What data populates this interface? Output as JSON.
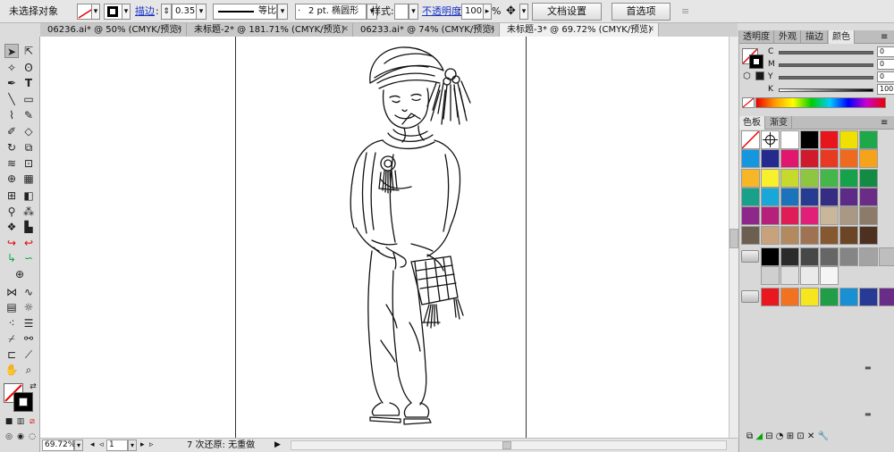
{
  "control_bar": {
    "selection_status": "未选择对象",
    "stroke_label": "描边",
    "stroke_weight": "0.353",
    "stroke_profile": "等比",
    "brush_value": "2 pt. 椭圆形",
    "style_label": "样式:",
    "opacity_label": "不透明度",
    "opacity_value": "100",
    "opacity_unit": "%",
    "doc_setup_button": "文档设置",
    "preferences_button": "首选项"
  },
  "tabs": [
    {
      "label": "06236.ai* @ 50% (CMYK/预览)"
    },
    {
      "label": "未标题-2* @ 181.71% (CMYK/预览)"
    },
    {
      "label": "06233.ai* @ 74% (CMYK/预览)"
    },
    {
      "label": "未标题-3* @ 69.72% (CMYK/预览)"
    }
  ],
  "status_bar": {
    "zoom": "69.72%",
    "page": "1",
    "undo_info": "7 次还原: 无重做"
  },
  "color_panel": {
    "tabs": [
      "透明度",
      "外观",
      "描边",
      "颜色"
    ],
    "sliders": [
      {
        "label": "C",
        "value": "0"
      },
      {
        "label": "M",
        "value": "0"
      },
      {
        "label": "Y",
        "value": "0"
      },
      {
        "label": "K",
        "value": "100"
      }
    ]
  },
  "swatches_panel": {
    "tabs": [
      "色板",
      "渐变"
    ],
    "rows": [
      [
        "#ffffff",
        "#ffffff",
        "#ffffff",
        "#000000",
        "#e8151c",
        "#f0e000",
        "#1ea84a"
      ],
      [
        "#1796e0",
        "#252a8f",
        "#e0166f",
        "#cf1a2d",
        "#e83a22",
        "#ee6a1e",
        "#f7a21b"
      ],
      [
        "#f7b625",
        "#f8f02d",
        "#c7d92c",
        "#8ec641",
        "#45b649",
        "#16a24a",
        "#148b45"
      ],
      [
        "#17a08a",
        "#19a7d7",
        "#1b74bb",
        "#263c92",
        "#352d83",
        "#5d2a88",
        "#6b2c88"
      ],
      [
        "#8d278a",
        "#b4207a",
        "#df1b58",
        "#e21f78",
        "#c8b79b",
        "#a99884",
        "#8c7b69"
      ],
      [
        "#6d5f50",
        "#c7a27c",
        "#b38a60",
        "#9f7352",
        "#86582f",
        "#6c4426",
        "#4d3020"
      ],
      [
        "#000000",
        "#2b2b2b",
        "#474747",
        "#666666",
        "#858585",
        "#a3a3a3",
        "#bebebe"
      ],
      [
        "#cfcfcf",
        "#dedede",
        "#eaeaea",
        "#f5f5f5"
      ],
      [
        "#e81720",
        "#f2721f",
        "#f6e61e",
        "#1f9e47",
        "#1990d3",
        "#273b96",
        "#6a2d87"
      ]
    ]
  },
  "colors": {
    "panel_bg": "#d8d8d8",
    "link_blue": "#1a35c7",
    "canvas_bg": "#ffffff"
  }
}
